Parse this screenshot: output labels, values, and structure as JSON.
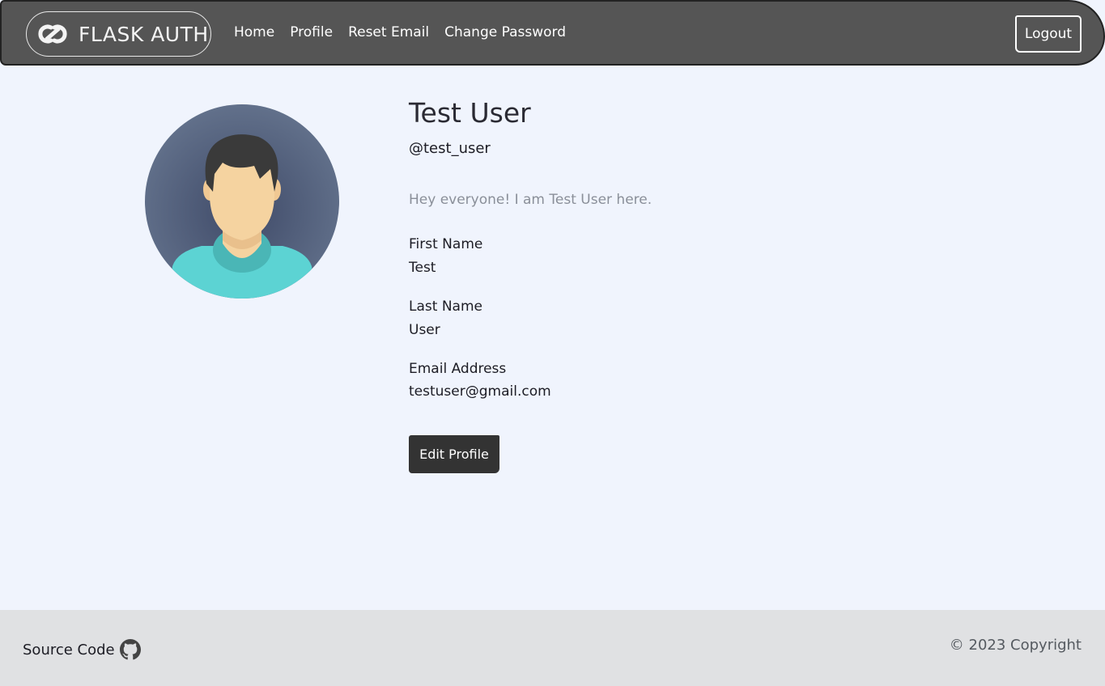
{
  "navbar": {
    "brand_text": "FLASK AUTH",
    "brand_icon": "chain-link-icon",
    "links": [
      {
        "label": "Home"
      },
      {
        "label": "Profile"
      },
      {
        "label": "Reset Email"
      },
      {
        "label": "Change Password"
      }
    ],
    "logout_label": "Logout",
    "background_color": "#555555"
  },
  "profile": {
    "avatar_icon": "user-avatar",
    "full_name": "Test User",
    "username": "@test_user",
    "bio": "Hey everyone! I am Test User here.",
    "fields": [
      {
        "label": "First Name",
        "value": "Test"
      },
      {
        "label": "Last Name",
        "value": "User"
      },
      {
        "label": "Email Address",
        "value": "testuser@gmail.com"
      }
    ],
    "edit_button_label": "Edit Profile"
  },
  "footer": {
    "source_label": "Source Code",
    "source_icon": "github-icon",
    "copyright": "© 2023 Copyright"
  },
  "colors": {
    "page_background": "#f0f4fd",
    "footer_background": "#e0e1e3",
    "button_dark": "#333333"
  }
}
